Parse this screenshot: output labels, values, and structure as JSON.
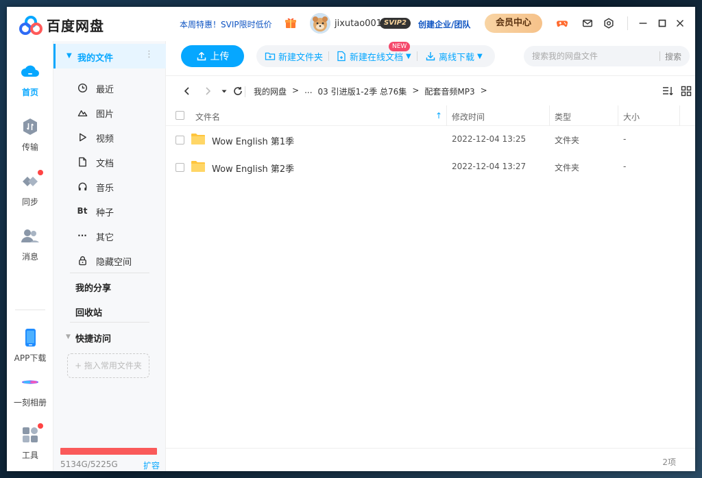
{
  "app": {
    "name": "百度网盘",
    "brand_color": "#06a7ff"
  },
  "titlebar": {
    "promo": "本周特惠！SVIP限时低价",
    "username": "jixutao001",
    "svip_badge": "SVIP2",
    "enterprise": "创建企业/团队",
    "vip_center": "会员中心"
  },
  "leftnav": {
    "items": [
      {
        "label": "首页",
        "icon": "cloud-home-icon",
        "active": true
      },
      {
        "label": "传输",
        "icon": "transfer-icon"
      },
      {
        "label": "同步",
        "icon": "sync-icon",
        "badge": true
      },
      {
        "label": "消息",
        "icon": "message-icon"
      },
      {
        "label": "APP下载",
        "icon": "phone-icon"
      },
      {
        "label": "一刻相册",
        "icon": "album-icon"
      },
      {
        "label": "工具",
        "icon": "tools-icon",
        "badge": true
      }
    ]
  },
  "sidebar": {
    "my_files": "我的文件",
    "items": [
      {
        "label": "最近",
        "icon": "clock-icon"
      },
      {
        "label": "图片",
        "icon": "image-icon"
      },
      {
        "label": "视频",
        "icon": "play-icon"
      },
      {
        "label": "文档",
        "icon": "document-icon"
      },
      {
        "label": "音乐",
        "icon": "headphones-icon"
      },
      {
        "label": "种子",
        "icon": "torrent-icon",
        "glyph": "Bt"
      },
      {
        "label": "其它",
        "icon": "ellipsis-icon",
        "glyph": "···"
      },
      {
        "label": "隐藏空间",
        "icon": "lock-icon"
      }
    ],
    "my_share": "我的分享",
    "recycle": "回收站",
    "quick_access": "快捷访问",
    "drop_hint": "+ 拖入常用文件夹",
    "quota": "5134G/5225G",
    "quota_fraction": 0.9826,
    "quota_color": "#fa5a5a",
    "expand": "扩容"
  },
  "toolbar": {
    "upload": "上传",
    "new_folder": "新建文件夹",
    "new_doc": "新建在线文档",
    "new_badge": "NEW",
    "offline_download": "离线下载",
    "search_placeholder": "搜索我的网盘文件",
    "search_btn": "搜索"
  },
  "breadcrumb": [
    "我的网盘",
    ">",
    "...",
    "03 引进版1-2季 总76集",
    ">",
    "配套音频MP3",
    ">"
  ],
  "table": {
    "headers": {
      "name": "文件名",
      "modified": "修改时间",
      "type": "类型",
      "size": "大小"
    },
    "rows": [
      {
        "name": "Wow English 第1季",
        "modified": "2022-12-04 13:25",
        "type": "文件夹",
        "size": "-"
      },
      {
        "name": "Wow English 第2季",
        "modified": "2022-12-04 13:27",
        "type": "文件夹",
        "size": "-"
      }
    ]
  },
  "status": {
    "count": "2项"
  }
}
